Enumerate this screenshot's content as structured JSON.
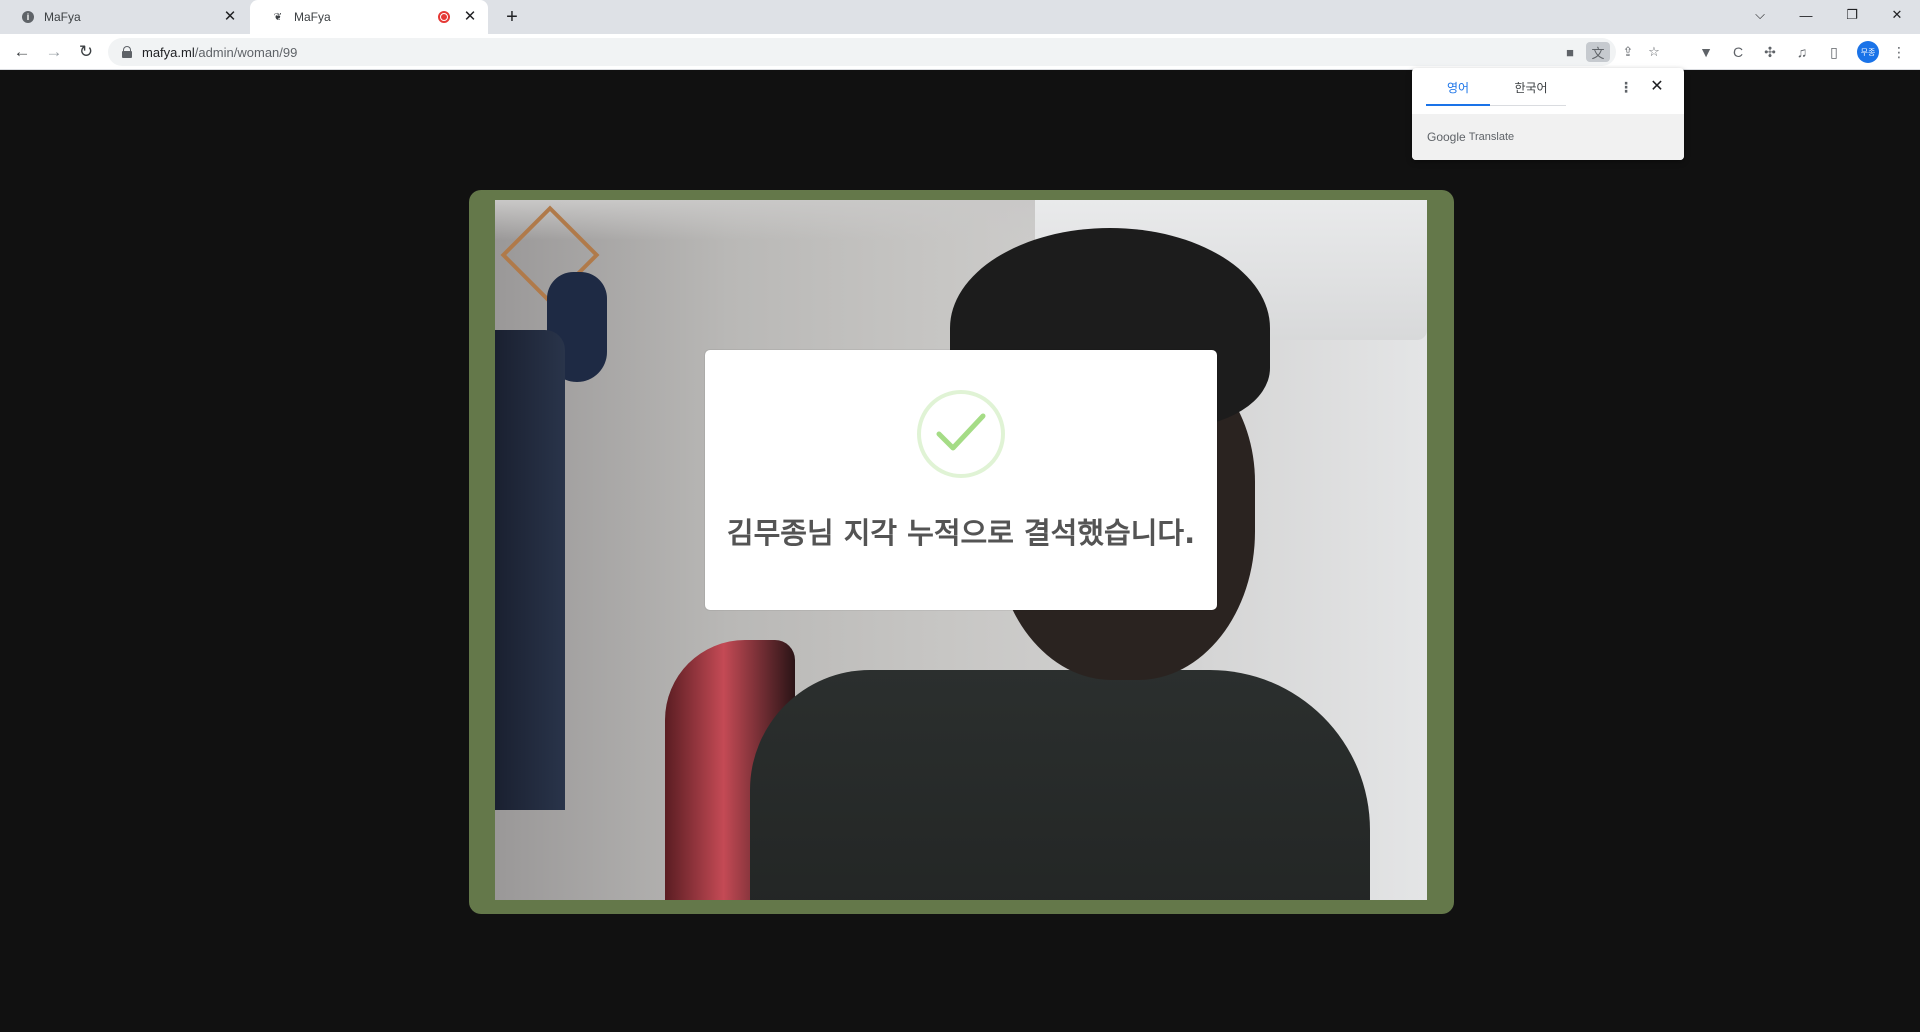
{
  "browser": {
    "tabs": [
      {
        "title": "MaFya",
        "favicon": "info-icon",
        "active": false
      },
      {
        "title": "MaFya",
        "favicon": "mafya-logo-icon",
        "active": true,
        "recording": true
      }
    ],
    "url_host": "mafya.ml",
    "url_path": "/admin/woman/99",
    "profile_initials": "무종"
  },
  "translate_popup": {
    "source_language": "영어",
    "target_language": "한국어",
    "brand": "Google",
    "product": "Translate"
  },
  "modal": {
    "icon": "success-check-icon",
    "message": "김무종님 지각 누적으로 결석했습니다."
  },
  "colors": {
    "page_background": "#111111",
    "video_frame": "#64784a",
    "success_green": "#a5dc86",
    "modal_text": "#545454",
    "accent_blue": "#1a73e8"
  }
}
